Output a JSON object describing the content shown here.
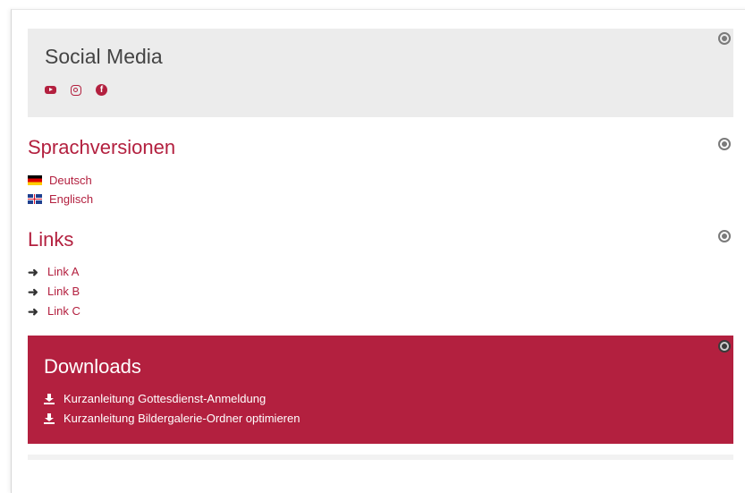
{
  "social": {
    "title": "Social Media",
    "icons": [
      "youtube-icon",
      "instagram-icon",
      "facebook-icon"
    ]
  },
  "languages": {
    "title": "Sprachversionen",
    "items": [
      {
        "label": "Deutsch",
        "flag": "german-flag-icon"
      },
      {
        "label": "Englisch",
        "flag": "uk-flag-icon"
      }
    ]
  },
  "links": {
    "title": "Links",
    "items": [
      {
        "label": "Link A"
      },
      {
        "label": "Link B"
      },
      {
        "label": "Link C"
      }
    ]
  },
  "downloads": {
    "title": "Downloads",
    "items": [
      {
        "label": "Kurzanleitung Gottesdienst-Anmeldung"
      },
      {
        "label": "Kurzanleitung Bildergalerie-Ordner optimieren"
      }
    ]
  },
  "colors": {
    "accent": "#b3203f",
    "panel": "#ececec",
    "text": "#444444"
  }
}
